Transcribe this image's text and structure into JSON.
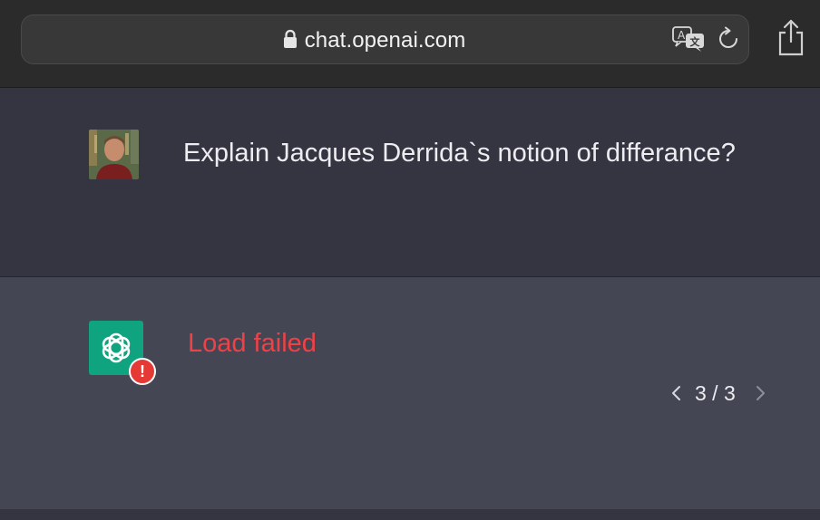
{
  "browser": {
    "url": "chat.openai.com",
    "icons": [
      "lock-icon",
      "translate-icon",
      "reload-icon",
      "share-icon"
    ]
  },
  "conversation": {
    "user_message": "Explain Jacques Derrida`s notion of differance?",
    "assistant_error": "Load failed",
    "pager": "3 / 3"
  },
  "colors": {
    "page_bg": "#343541",
    "assistant_bg": "#444654",
    "error_red": "#ef4146",
    "openai_green": "#10a37f"
  }
}
